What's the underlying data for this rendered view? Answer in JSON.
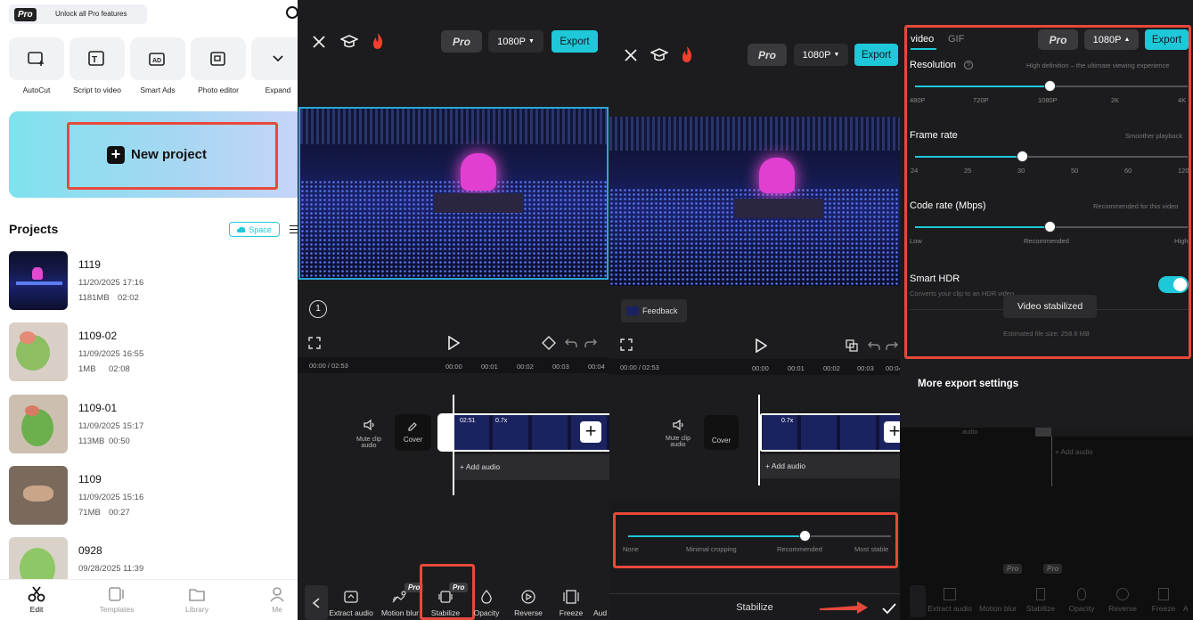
{
  "panel1": {
    "pro_badge": "Pro",
    "unlock_text": "Unlock all Pro features",
    "tools": [
      {
        "label": "AutoCut",
        "icon": "autocut-icon"
      },
      {
        "label": "Script to video",
        "icon": "script-icon"
      },
      {
        "label": "Smart Ads",
        "icon": "smart-ads-icon"
      },
      {
        "label": "Photo editor",
        "icon": "photo-editor-icon"
      },
      {
        "label": "Expand",
        "icon": "chevron-down-icon"
      }
    ],
    "new_project": "New project",
    "projects_title": "Projects",
    "space_badge": "Space",
    "projects": [
      {
        "name": "1119",
        "date": "11/20/2025 17:16",
        "size": "1181MB",
        "duration": "02:02"
      },
      {
        "name": "1109-02",
        "date": "11/09/2025 16:55",
        "size": "1MB",
        "duration": "02:08"
      },
      {
        "name": "1109-01",
        "date": "11/09/2025 15:17",
        "size": "113MB",
        "duration": "00:50"
      },
      {
        "name": "1109",
        "date": "11/09/2025 15:16",
        "size": "71MB",
        "duration": "00:27"
      },
      {
        "name": "0928",
        "date": "09/28/2025 11:39",
        "size": "",
        "duration": ""
      }
    ],
    "nav": [
      {
        "label": "Edit"
      },
      {
        "label": "Templates"
      },
      {
        "label": "Library"
      },
      {
        "label": "Me"
      }
    ]
  },
  "editor": {
    "pro_label": "Pro",
    "resolution": "1080P",
    "export": "Export",
    "step_number": "1",
    "time_current": "00:00",
    "time_total": "02:53",
    "ticks_a": [
      "00:00",
      "00:01",
      "00:02",
      "00:03",
      "00:04"
    ],
    "ticks_b": [
      "00:00",
      "00:01",
      "00:02",
      "00:03",
      "00:04"
    ],
    "mute_label": "Mute clip audio",
    "cover_label": "Cover",
    "clip_duration": "02:51",
    "clip_speed": "0.7x",
    "add_audio": "+ Add audio",
    "toolbar": [
      "Extract audio",
      "Motion blur",
      "Stabilize",
      "Opacity",
      "Reverse",
      "Freeze",
      "Aud"
    ],
    "pro_tag": "Pro"
  },
  "stabilize": {
    "feedback": "Feedback",
    "slider_labels": [
      "None",
      "Minimal cropping",
      "Recommended",
      "Most stable"
    ],
    "slider_value_fraction": 0.67,
    "title": "Stabilize"
  },
  "export_panel": {
    "tabs": [
      "video",
      "GIF"
    ],
    "pro_label": "Pro",
    "resolution_btn": "1080P",
    "export": "Export",
    "resolution_title": "Resolution",
    "resolution_hint": "High definition – the ultimate viewing experience",
    "resolution_ticks": [
      "480P",
      "720P",
      "1080P",
      "2K",
      "4K"
    ],
    "resolution_value": "1080P",
    "frame_title": "Frame rate",
    "frame_hint": "Smoother playback",
    "frame_ticks": [
      "24",
      "25",
      "30",
      "50",
      "60",
      "120"
    ],
    "frame_value": "30",
    "code_title": "Code rate (Mbps)",
    "code_hint": "Recommended for this video",
    "code_ticks": [
      "Low",
      "Recommended",
      "High"
    ],
    "code_value": "Recommended",
    "hdr_title": "Smart HDR",
    "hdr_hint": "Converts your clip to an HDR video",
    "hdr_on": true,
    "toast": "Video stabilized",
    "estimated": "Estimated file size: 258.6 MB",
    "more_settings": "More export settings",
    "bg_add_audio": "+ Add audio",
    "bg_audio": "audio",
    "bg_toolbar": [
      "Extract audio",
      "Motion blur",
      "Stabilize",
      "Opacity",
      "Reverse",
      "Freeze",
      "A"
    ]
  },
  "colors": {
    "accent": "#1ec8d8",
    "highlight": "#e8483b",
    "selection": "#2ba6d6"
  }
}
